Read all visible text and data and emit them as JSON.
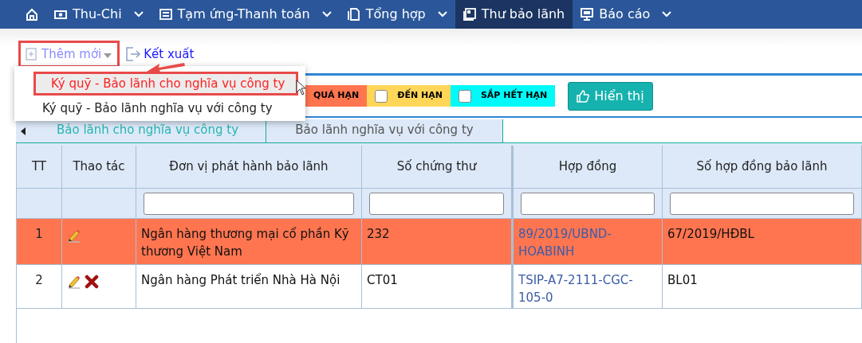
{
  "nav": {
    "items": [
      {
        "kind": "home",
        "selected": false
      },
      {
        "kind": "menu",
        "label": "Thu-Chi",
        "dropdown": true,
        "selected": false
      },
      {
        "kind": "menu",
        "label": "Tạm ứng-Thanh toán",
        "dropdown": true,
        "selected": false
      },
      {
        "kind": "menu",
        "label": "Tổng hợp",
        "dropdown": true,
        "selected": false
      },
      {
        "kind": "menu",
        "label": "Thư bảo lãnh",
        "dropdown": false,
        "selected": true
      },
      {
        "kind": "menu",
        "label": "Báo cáo",
        "dropdown": true,
        "selected": false
      }
    ]
  },
  "toolbar": {
    "add_button": {
      "label": "Thêm mới",
      "expanded": true
    },
    "export_link": {
      "label": "Kết xuất"
    }
  },
  "add_menu": [
    {
      "label": "Ký quỹ - Bảo lãnh cho nghĩa vụ công ty",
      "selected": true
    },
    {
      "label": "Ký quỹ - Bảo lãnh nghĩa vụ với công ty",
      "selected": false
    }
  ],
  "legend": [
    {
      "label": "QUÁ HẠN",
      "color": "#ff7550"
    },
    {
      "label": "ĐẾN HẠN",
      "color": "#ffd658",
      "checked": false
    },
    {
      "label": "SẮP HẾT HẠN",
      "color": "#00f9f9",
      "checked": false
    }
  ],
  "show_button": {
    "label": "Hiển thị"
  },
  "tabs": [
    {
      "label": "Bảo lãnh cho nghĩa vụ công ty",
      "selected": true
    },
    {
      "label": "Bảo lãnh nghĩa vụ với công ty",
      "selected": false
    }
  ],
  "table": {
    "columns": [
      {
        "label": "TT",
        "filter": false
      },
      {
        "label": "Thao tác",
        "filter": false
      },
      {
        "label": "Đơn vị phát hành bảo lãnh",
        "filter": true
      },
      {
        "label": "Số chứng thư",
        "filter": true
      },
      {
        "label": "Hợp đồng",
        "filter": true
      },
      {
        "label": "Số hợp đồng bảo lãnh",
        "filter": true
      }
    ],
    "rows": [
      {
        "tt": "1",
        "can_edit": true,
        "can_delete": false,
        "issuer": "Ngân hàng thương mại cổ phần Kỹ thương Việt Nam",
        "certificate_no": "232",
        "contract": "89/2019/UBND-HOABINH",
        "guarantee_no": "67/2019/HĐBL",
        "overdue": true
      },
      {
        "tt": "2",
        "can_edit": true,
        "can_delete": true,
        "issuer": "Ngân hàng Phát triển Nhà Hà Nội",
        "certificate_no": "CT01",
        "contract": "TSIP-A7-2111-CGC-105-0",
        "guarantee_no": "BL01",
        "overdue": false
      }
    ]
  }
}
